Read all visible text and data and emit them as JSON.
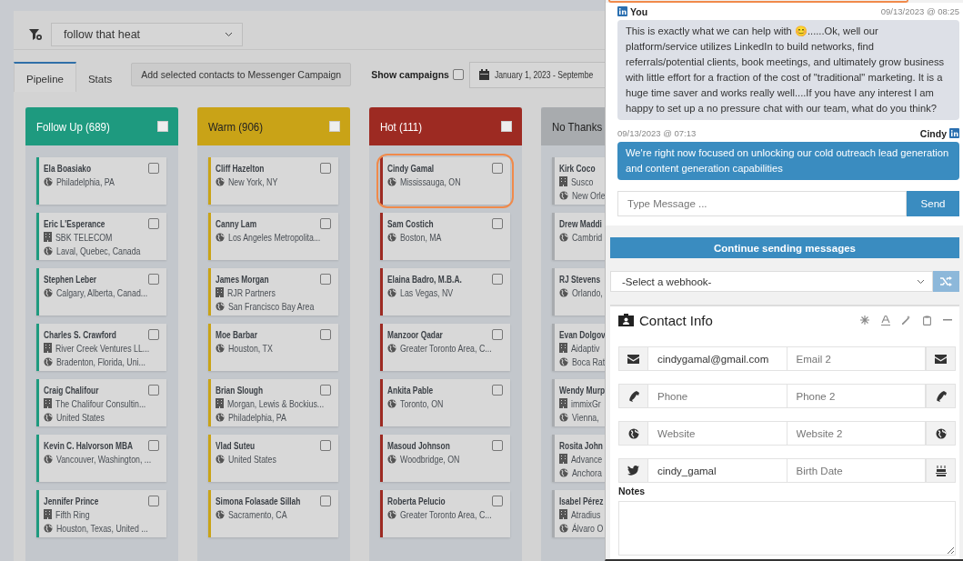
{
  "filter": {
    "value": "follow that heat"
  },
  "tabs": [
    {
      "label": "Pipeline",
      "selected": true
    },
    {
      "label": "Stats",
      "selected": false
    }
  ],
  "add_button": "Add selected contacts to Messenger Campaign",
  "show_campaigns": {
    "label": "Show campaigns",
    "checked": false
  },
  "date_range": "January 1, 2023 - Septembe",
  "columns": [
    {
      "title": "Follow Up (689)",
      "color": "#1e9a7f",
      "checked": false,
      "cards": [
        {
          "name": "Ela Boasiako",
          "location": "Philadelphia, PA",
          "checked": false,
          "highlighted": false
        },
        {
          "name": "Eric L'Esperance",
          "company": "SBK TELECOM",
          "location": "Laval, Quebec, Canada",
          "checked": false,
          "highlighted": false
        },
        {
          "name": "Stephen Leber",
          "location": "Calgary, Alberta, Canad...",
          "checked": false,
          "highlighted": false
        },
        {
          "name": "Charles S. Crawford",
          "company": "River Creek Ventures LL...",
          "location": "Bradenton, Florida, Uni...",
          "checked": false,
          "highlighted": false
        },
        {
          "name": "Craig Chalifour",
          "company": "The Chalifour Consultin...",
          "location": "United States",
          "checked": false,
          "highlighted": false
        },
        {
          "name": "Kevin C. Halvorson MBA",
          "location": "Vancouver, Washington, ...",
          "checked": false,
          "highlighted": false
        },
        {
          "name": "Jennifer Prince",
          "company": "Fifth Ring",
          "location": "Houston, Texas, United ...",
          "checked": false,
          "highlighted": false
        }
      ]
    },
    {
      "title": "Warm (906)",
      "color": "#c9a317",
      "checked": false,
      "cards": [
        {
          "name": "Cliff Hazelton",
          "location": "New York, NY",
          "checked": false,
          "highlighted": false
        },
        {
          "name": "Canny Lam",
          "location": "Los Angeles Metropolita...",
          "checked": false,
          "highlighted": false
        },
        {
          "name": "James Morgan",
          "company": "RJR Partners",
          "location": "San Francisco Bay Area",
          "checked": false,
          "highlighted": false
        },
        {
          "name": "Moe Barbar",
          "location": "Houston, TX",
          "checked": false,
          "highlighted": false
        },
        {
          "name": "Brian Slough",
          "company": "Morgan, Lewis & Bockius...",
          "location": "Philadelphia, PA",
          "checked": false,
          "highlighted": false
        },
        {
          "name": "Vlad Suteu",
          "location": "United States",
          "checked": false,
          "highlighted": false
        },
        {
          "name": "Simona Folasade Sillah",
          "location": "Sacramento, CA",
          "checked": false,
          "highlighted": false
        }
      ]
    },
    {
      "title": "Hot (111)",
      "color": "#9d2a22",
      "checked": false,
      "cards": [
        {
          "name": "Cindy Gamal",
          "location": "Mississauga, ON",
          "checked": false,
          "highlighted": true
        },
        {
          "name": "Sam Costich",
          "location": "Boston, MA",
          "checked": false,
          "highlighted": false
        },
        {
          "name": "Elaina Badro, M.B.A.",
          "location": "Las Vegas, NV",
          "checked": false,
          "highlighted": false
        },
        {
          "name": "Manzoor Qadar",
          "location": "Greater Toronto Area, C...",
          "checked": false,
          "highlighted": false
        },
        {
          "name": "Ankita Pable",
          "location": "Toronto, ON",
          "checked": false,
          "highlighted": false
        },
        {
          "name": "Masoud Johnson",
          "location": "Woodbridge, ON",
          "checked": false,
          "highlighted": false
        },
        {
          "name": "Roberta Pelucio",
          "location": "Greater Toronto Area, C...",
          "checked": false,
          "highlighted": false
        }
      ]
    },
    {
      "title": "No Thanks",
      "color": "#a8abae",
      "cards": [
        {
          "name": "Kirk Coco",
          "company": "Susco",
          "location": "New Orle",
          "highlighted": false
        },
        {
          "name": "Drew Maddi",
          "location": "Cambrid",
          "highlighted": false
        },
        {
          "name": "RJ Stevens",
          "location": "Orlando,",
          "highlighted": false
        },
        {
          "name": "Evan Dolgov",
          "company": "Aidaptiv",
          "location": "Boca Rat",
          "highlighted": false
        },
        {
          "name": "Wendy Murp",
          "company": "immixGr",
          "location": "Vienna,",
          "highlighted": false
        },
        {
          "name": "Rosita John",
          "company": "Advance",
          "location": "Anchora",
          "highlighted": false
        },
        {
          "name": "Isabel Pérez",
          "company": "Atradius",
          "location": "Álvaro O",
          "highlighted": false
        }
      ]
    }
  ],
  "messages": [
    {
      "kind": "outgoing",
      "sender": "You",
      "time": "09/13/2023 @ 08:25",
      "text": "This is exactly what we can help with 😊......Ok, well our platform/service utilizes LinkedIn to build networks, find referrals/potential clients, book meetings, and ultimately grow business with little effort for a fraction of the cost of \"traditional\" marketing. It is a huge time saver and works really well....If you have any interest I am happy to set up a no pressure chat with our team, what do you think?"
    },
    {
      "kind": "incoming",
      "sender": "Cindy",
      "time": "09/13/2023 @ 07:13",
      "text": "We're right now focused on unlocking our cold outreach lead generation and content generation capabilities"
    }
  ],
  "message_input": {
    "placeholder": "Type Message ..."
  },
  "send_button": "Send",
  "continue_button": "Continue sending messages",
  "webhook_select": {
    "value": "-Select a webhook-"
  },
  "contact_info": {
    "title": "Contact Info",
    "rows": [
      {
        "kind": "email",
        "fields": [
          {
            "value": "cindygamal@gmail.com"
          },
          {
            "placeholder": "Email 2"
          }
        ]
      },
      {
        "kind": "phone",
        "fields": [
          {
            "placeholder": "Phone"
          },
          {
            "placeholder": "Phone 2"
          }
        ]
      },
      {
        "kind": "website",
        "fields": [
          {
            "placeholder": "Website"
          },
          {
            "placeholder": "Website 2"
          }
        ]
      },
      {
        "kind": "social",
        "fields": [
          {
            "value": "cindy_gamal"
          },
          {
            "placeholder": "Birth Date"
          }
        ]
      }
    ],
    "notes_label": "Notes"
  }
}
